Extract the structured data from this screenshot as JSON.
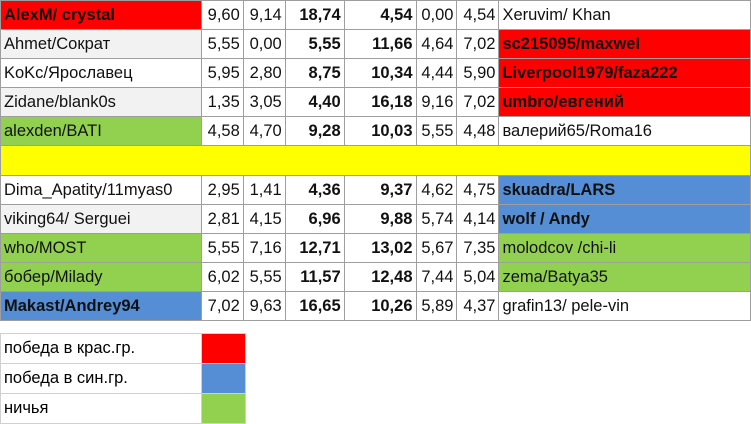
{
  "rows_top": [
    {
      "left": "AlexM/ crystal",
      "a": "9,60",
      "b": "9,14",
      "c": "18,74",
      "d": "4,54",
      "e": "0,00",
      "f": "4,54",
      "right": "Xeruvim/ Khan",
      "lc": "red",
      "rc": "white",
      "lb": true,
      "rb": false
    },
    {
      "left": "Ahmet/Сократ",
      "a": "5,55",
      "b": "0,00",
      "c": "5,55",
      "d": "11,66",
      "e": "4,64",
      "f": "7,02",
      "right": "sc215095/maxwel",
      "lc": "grey",
      "rc": "red",
      "lb": false,
      "rb": true
    },
    {
      "left": "KoKc/Ярославец",
      "a": "5,95",
      "b": "2,80",
      "c": "8,75",
      "d": "10,34",
      "e": "4,44",
      "f": "5,90",
      "right": "Liverpool1979/faza222",
      "lc": "white",
      "rc": "red",
      "lb": false,
      "rb": true
    },
    {
      "left": "Zidane/blank0s",
      "a": "1,35",
      "b": "3,05",
      "c": "4,40",
      "d": "16,18",
      "e": "9,16",
      "f": "7,02",
      "right": "umbro/евгений",
      "lc": "grey",
      "rc": "red",
      "lb": false,
      "rb": true
    },
    {
      "left": "alexden/BATI",
      "a": "4,58",
      "b": "4,70",
      "c": "9,28",
      "d": "10,03",
      "e": "5,55",
      "f": "4,48",
      "right": "валерий65/Roma16",
      "lc": "green",
      "rc": "white",
      "lb": false,
      "rb": false
    }
  ],
  "rows_bottom": [
    {
      "left": "Dima_Apatity/11myas0",
      "a": "2,95",
      "b": "1,41",
      "c": "4,36",
      "d": "9,37",
      "e": "4,62",
      "f": "4,75",
      "right": " skuadra/LARS",
      "lc": "white",
      "rc": "blue",
      "lb": false,
      "rb": true
    },
    {
      "left": "viking64/ Serguei",
      "a": "2,81",
      "b": "4,15",
      "c": "6,96",
      "d": "9,88",
      "e": "5,74",
      "f": "4,14",
      "right": "wolf / Andy",
      "lc": "grey",
      "rc": "blue",
      "lb": false,
      "rb": true
    },
    {
      "left": "who/MOST",
      "a": "5,55",
      "b": "7,16",
      "c": "12,71",
      "d": "13,02",
      "e": "5,67",
      "f": "7,35",
      "right": " molodcov /chi-li",
      "lc": "green",
      "rc": "green",
      "lb": false,
      "rb": false
    },
    {
      "left": "бобер/Milady",
      "a": "6,02",
      "b": "5,55",
      "c": "11,57",
      "d": "12,48",
      "e": "7,44",
      "f": "5,04",
      "right": " zema/Batya35",
      "lc": "green",
      "rc": "green",
      "lb": false,
      "rb": false
    },
    {
      "left": "Makast/Andrey94",
      "a": "7,02",
      "b": "9,63",
      "c": "16,65",
      "d": "10,26",
      "e": "5,89",
      "f": "4,37",
      "right": "grafin13/ pele-vin",
      "lc": "blue",
      "rc": "white",
      "lb": true,
      "rb": false
    }
  ],
  "legend": [
    {
      "label": "победа в крас.гр.",
      "color": "red"
    },
    {
      "label": "победа в син.гр.",
      "color": "blue"
    },
    {
      "label": "ничья",
      "color": "green"
    }
  ]
}
